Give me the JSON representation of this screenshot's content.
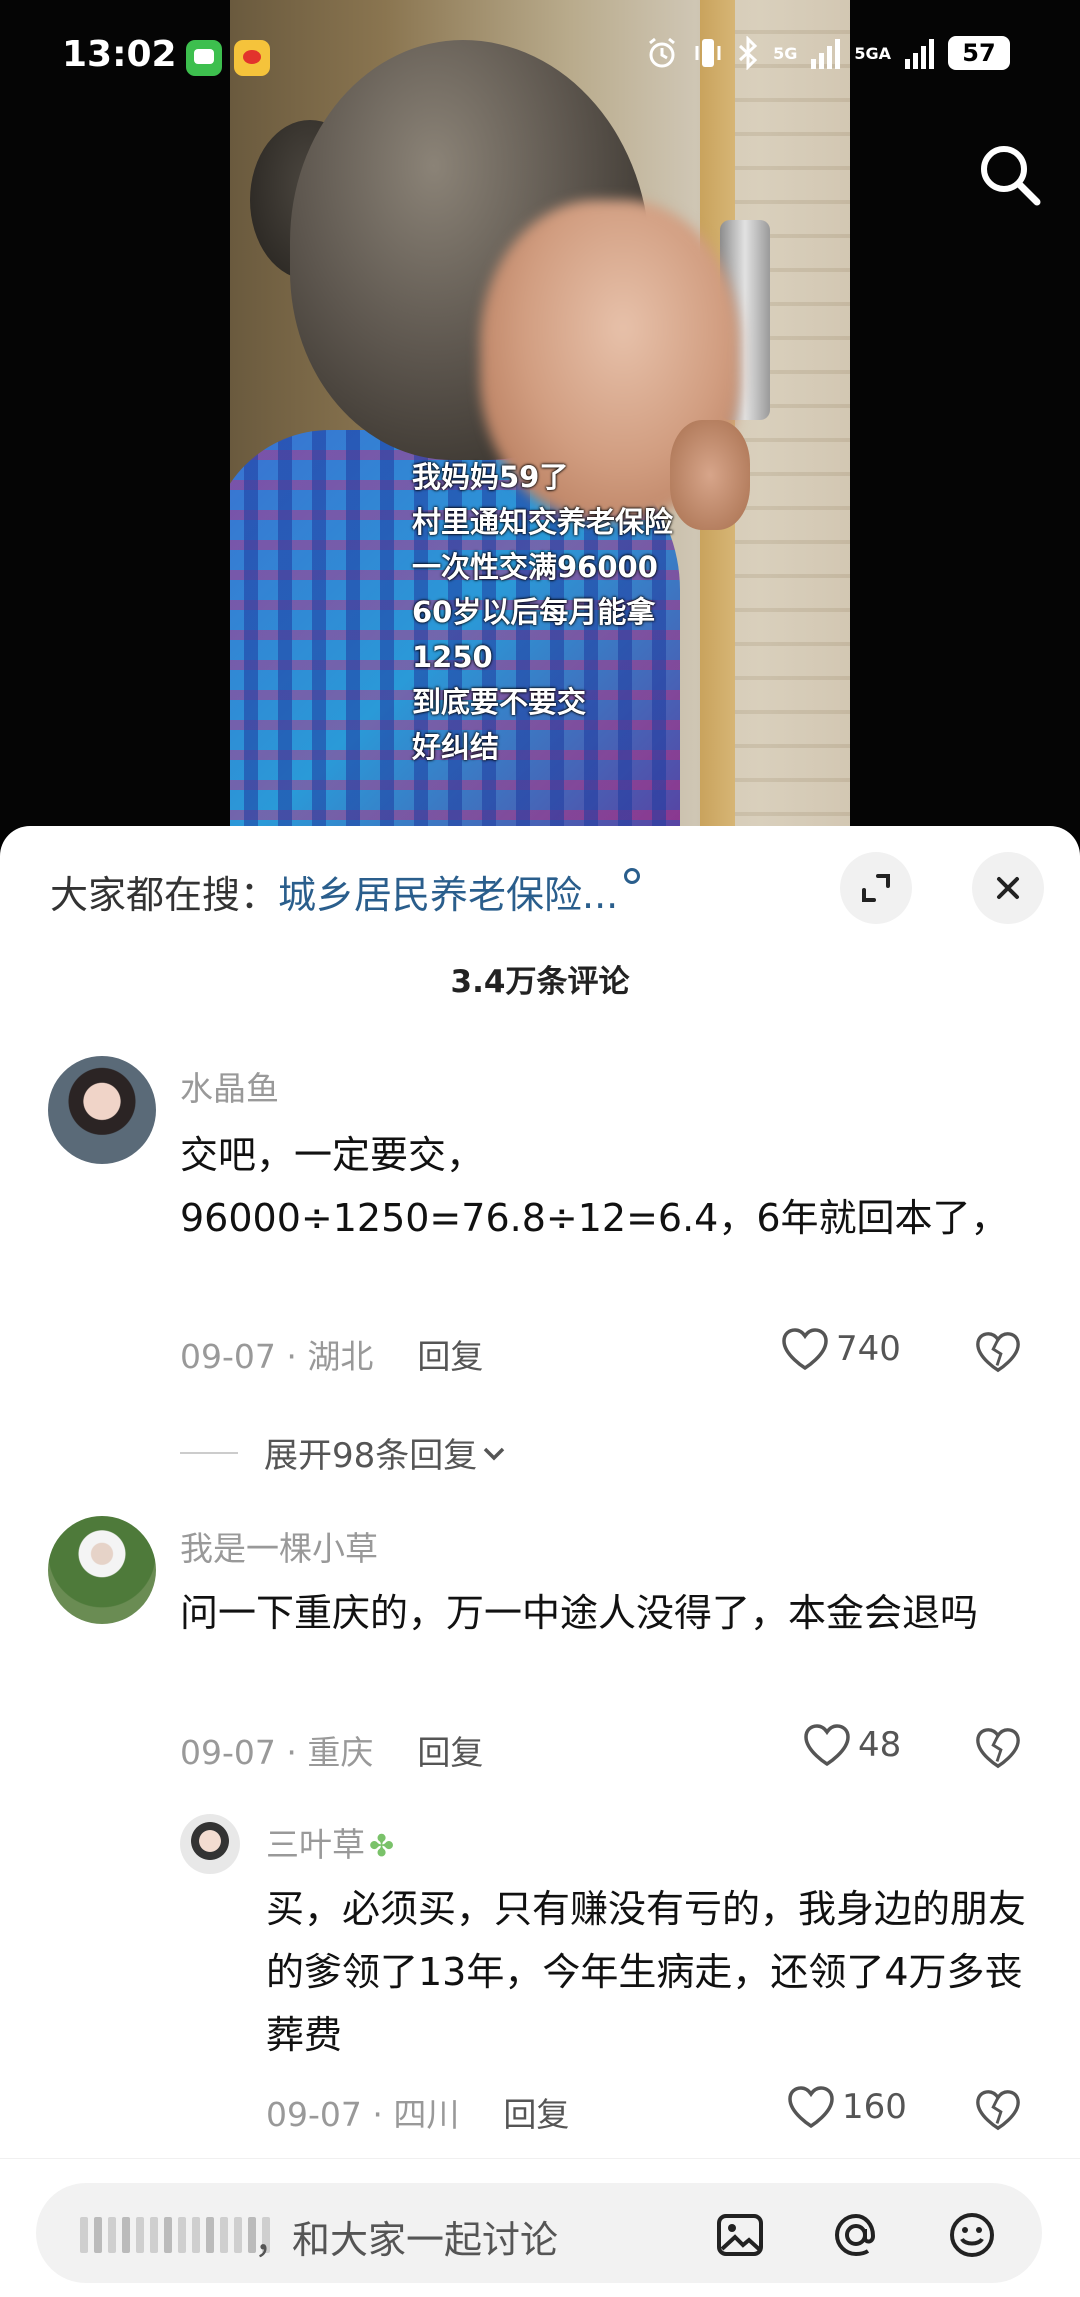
{
  "status_bar": {
    "time": "13:02",
    "network1": "5G",
    "network2": "5GA",
    "battery": "57"
  },
  "video": {
    "caption": "我妈妈59了\n村里通知交养老保险\n一次性交满96000\n60岁以后每月能拿\n1250\n到底要不要交\n好纠结"
  },
  "sheet": {
    "trending_prefix": "大家都在搜：",
    "trending_keyword": "城乡居民养老保险...",
    "comment_count": "3.4万条评论",
    "comments": [
      {
        "name": "水晶鱼",
        "text": "交吧，一定要交，\n96000÷1250=76.8÷12=6.4，6年就回本了，",
        "date": "09-07 · 湖北",
        "reply": "回复",
        "likes": "740"
      },
      {
        "name": "我是一棵小草",
        "text": "问一下重庆的，万一中途人没得了，本金会退吗",
        "date": "09-07 · 重庆",
        "reply": "回复",
        "likes": "48"
      },
      {
        "name": "三叶草",
        "text": "买，必须买，只有赚没有亏的，我身边的朋友的爹领了13年，今年生病走，还领了4万多丧葬费",
        "date": "09-07 · 四川",
        "reply": "回复",
        "likes": "160"
      }
    ],
    "expand_replies": "展开98条回复"
  },
  "input": {
    "placeholder": "，和大家一起讨论"
  }
}
